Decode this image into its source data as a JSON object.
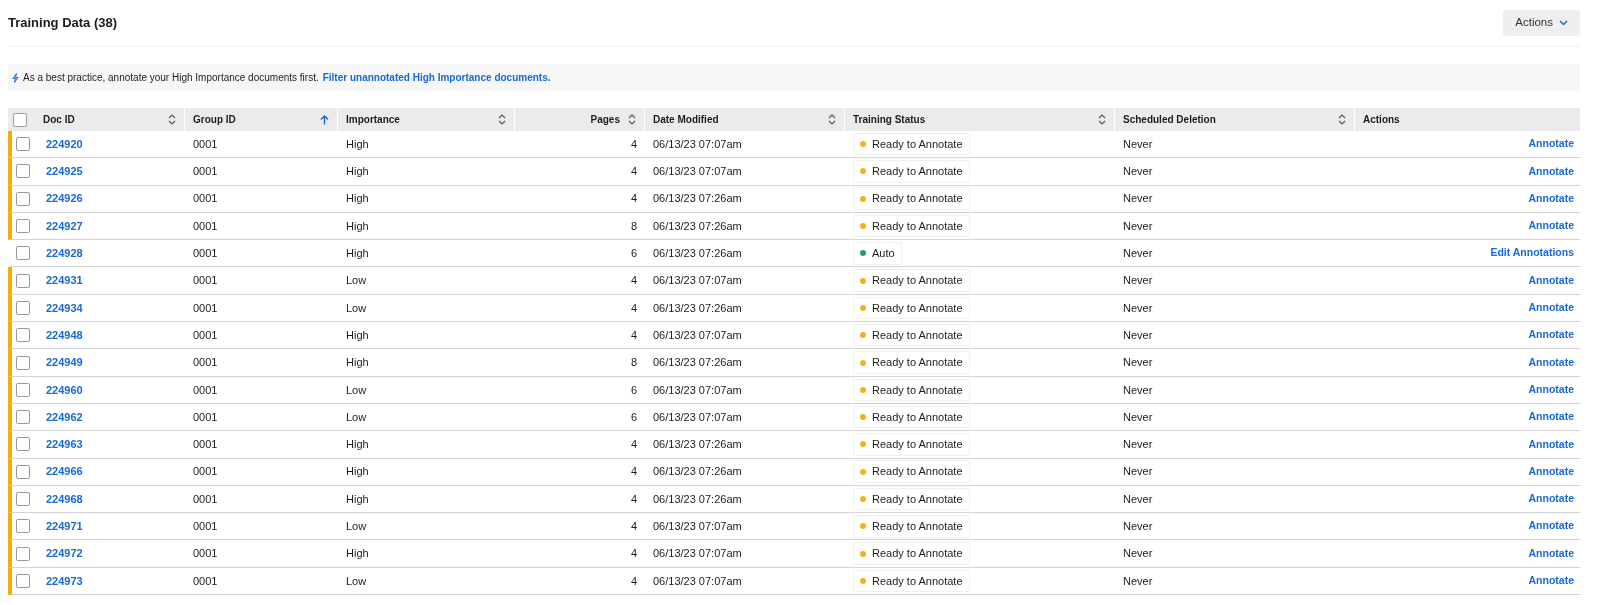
{
  "title": "Training Data (38)",
  "actions_button": {
    "label": "Actions"
  },
  "banner": {
    "text": "As a best practice, annotate your High Importance documents first.",
    "link": "Filter unannotated High Importance documents."
  },
  "table": {
    "select_all": {
      "checked": false
    },
    "columns": [
      {
        "label": "Doc ID",
        "sortable": true,
        "sorted": false,
        "numeric": false
      },
      {
        "label": "Group ID",
        "sortable": true,
        "sorted": true,
        "numeric": false
      },
      {
        "label": "Importance",
        "sortable": true,
        "sorted": false,
        "numeric": false
      },
      {
        "label": "Pages",
        "sortable": true,
        "sorted": false,
        "numeric": true
      },
      {
        "label": "Date Modified",
        "sortable": true,
        "sorted": false,
        "numeric": false
      },
      {
        "label": "Training Status",
        "sortable": true,
        "sorted": false,
        "numeric": false
      },
      {
        "label": "Scheduled Deletion",
        "sortable": true,
        "sorted": false,
        "numeric": false
      },
      {
        "label": "Actions",
        "sortable": false,
        "sorted": false,
        "numeric": false
      }
    ],
    "rows": [
      {
        "flagged": true,
        "checked": false,
        "doc_id": "224920",
        "group_id": "0001",
        "importance": "High",
        "pages": "4",
        "date": "06/13/23 07:07am",
        "status": {
          "label": "Ready to Annotate",
          "color": "#f5b21b"
        },
        "deletion": "Never",
        "action": "Annotate"
      },
      {
        "flagged": true,
        "checked": false,
        "doc_id": "224925",
        "group_id": "0001",
        "importance": "High",
        "pages": "4",
        "date": "06/13/23 07:07am",
        "status": {
          "label": "Ready to Annotate",
          "color": "#f5b21b"
        },
        "deletion": "Never",
        "action": "Annotate"
      },
      {
        "flagged": true,
        "checked": false,
        "doc_id": "224926",
        "group_id": "0001",
        "importance": "High",
        "pages": "4",
        "date": "06/13/23 07:26am",
        "status": {
          "label": "Ready to Annotate",
          "color": "#f5b21b"
        },
        "deletion": "Never",
        "action": "Annotate"
      },
      {
        "flagged": true,
        "checked": false,
        "doc_id": "224927",
        "group_id": "0001",
        "importance": "High",
        "pages": "8",
        "date": "06/13/23 07:26am",
        "status": {
          "label": "Ready to Annotate",
          "color": "#f5b21b"
        },
        "deletion": "Never",
        "action": "Annotate"
      },
      {
        "flagged": false,
        "checked": false,
        "doc_id": "224928",
        "group_id": "0001",
        "importance": "High",
        "pages": "6",
        "date": "06/13/23 07:26am",
        "status": {
          "label": "Auto",
          "color": "#1a9c7a"
        },
        "deletion": "Never",
        "action": "Edit Annotations"
      },
      {
        "flagged": true,
        "checked": false,
        "doc_id": "224931",
        "group_id": "0001",
        "importance": "Low",
        "pages": "4",
        "date": "06/13/23 07:07am",
        "status": {
          "label": "Ready to Annotate",
          "color": "#f5b21b"
        },
        "deletion": "Never",
        "action": "Annotate"
      },
      {
        "flagged": true,
        "checked": false,
        "doc_id": "224934",
        "group_id": "0001",
        "importance": "Low",
        "pages": "4",
        "date": "06/13/23 07:26am",
        "status": {
          "label": "Ready to Annotate",
          "color": "#f5b21b"
        },
        "deletion": "Never",
        "action": "Annotate"
      },
      {
        "flagged": true,
        "checked": false,
        "doc_id": "224948",
        "group_id": "0001",
        "importance": "High",
        "pages": "4",
        "date": "06/13/23 07:07am",
        "status": {
          "label": "Ready to Annotate",
          "color": "#f5b21b"
        },
        "deletion": "Never",
        "action": "Annotate"
      },
      {
        "flagged": true,
        "checked": false,
        "doc_id": "224949",
        "group_id": "0001",
        "importance": "High",
        "pages": "8",
        "date": "06/13/23 07:26am",
        "status": {
          "label": "Ready to Annotate",
          "color": "#f5b21b"
        },
        "deletion": "Never",
        "action": "Annotate"
      },
      {
        "flagged": true,
        "checked": false,
        "doc_id": "224960",
        "group_id": "0001",
        "importance": "Low",
        "pages": "6",
        "date": "06/13/23 07:07am",
        "status": {
          "label": "Ready to Annotate",
          "color": "#f5b21b"
        },
        "deletion": "Never",
        "action": "Annotate"
      },
      {
        "flagged": true,
        "checked": false,
        "doc_id": "224962",
        "group_id": "0001",
        "importance": "Low",
        "pages": "6",
        "date": "06/13/23 07:07am",
        "status": {
          "label": "Ready to Annotate",
          "color": "#f5b21b"
        },
        "deletion": "Never",
        "action": "Annotate"
      },
      {
        "flagged": true,
        "checked": false,
        "doc_id": "224963",
        "group_id": "0001",
        "importance": "High",
        "pages": "4",
        "date": "06/13/23 07:26am",
        "status": {
          "label": "Ready to Annotate",
          "color": "#f5b21b"
        },
        "deletion": "Never",
        "action": "Annotate"
      },
      {
        "flagged": true,
        "checked": false,
        "doc_id": "224966",
        "group_id": "0001",
        "importance": "High",
        "pages": "4",
        "date": "06/13/23 07:26am",
        "status": {
          "label": "Ready to Annotate",
          "color": "#f5b21b"
        },
        "deletion": "Never",
        "action": "Annotate"
      },
      {
        "flagged": true,
        "checked": false,
        "doc_id": "224968",
        "group_id": "0001",
        "importance": "High",
        "pages": "4",
        "date": "06/13/23 07:26am",
        "status": {
          "label": "Ready to Annotate",
          "color": "#f5b21b"
        },
        "deletion": "Never",
        "action": "Annotate"
      },
      {
        "flagged": true,
        "checked": false,
        "doc_id": "224971",
        "group_id": "0001",
        "importance": "Low",
        "pages": "4",
        "date": "06/13/23 07:07am",
        "status": {
          "label": "Ready to Annotate",
          "color": "#f5b21b"
        },
        "deletion": "Never",
        "action": "Annotate"
      },
      {
        "flagged": true,
        "checked": false,
        "doc_id": "224972",
        "group_id": "0001",
        "importance": "High",
        "pages": "4",
        "date": "06/13/23 07:07am",
        "status": {
          "label": "Ready to Annotate",
          "color": "#f5b21b"
        },
        "deletion": "Never",
        "action": "Annotate"
      },
      {
        "flagged": true,
        "checked": false,
        "doc_id": "224973",
        "group_id": "0001",
        "importance": "Low",
        "pages": "4",
        "date": "06/13/23 07:07am",
        "status": {
          "label": "Ready to Annotate",
          "color": "#f5b21b"
        },
        "deletion": "Never",
        "action": "Annotate"
      }
    ]
  }
}
